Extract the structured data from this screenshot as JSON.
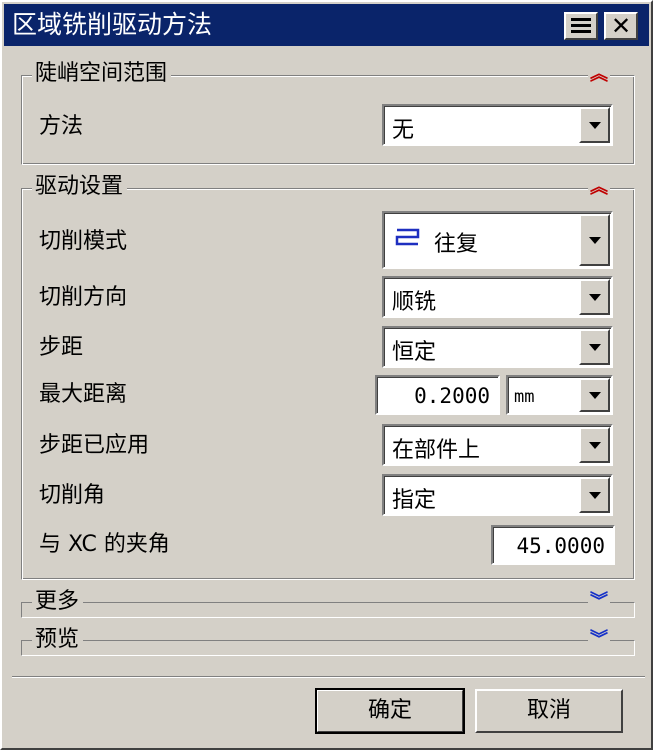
{
  "window": {
    "title": "区域铣削驱动方法",
    "close_symbol": "✕"
  },
  "steep_group": {
    "title": "陡峭空间范围",
    "method_label": "方法",
    "method_value": "无"
  },
  "drive_group": {
    "title": "驱动设置",
    "cut_pattern_label": "切削模式",
    "cut_pattern_value": "往复",
    "cut_direction_label": "切削方向",
    "cut_direction_value": "顺铣",
    "stepover_label": "步距",
    "stepover_value": "恒定",
    "max_distance_label": "最大距离",
    "max_distance_value": "0.2000",
    "max_distance_unit": "mm",
    "stepover_applied_label": "步距已应用",
    "stepover_applied_value": "在部件上",
    "cut_angle_label": "切削角",
    "cut_angle_value": "指定",
    "xc_angle_label": "与 XC 的夹角",
    "xc_angle_value": "45.0000"
  },
  "more_group": {
    "title": "更多"
  },
  "preview_group": {
    "title": "预览"
  },
  "buttons": {
    "ok_label": "确定",
    "cancel_label": "取消"
  },
  "icons": {
    "collapse": "double-chevron-up-icon",
    "expand": "double-chevron-down-icon",
    "zigzag": "zig-zag-pattern-icon"
  },
  "colors": {
    "titlebar": "#0a246a",
    "collapse_chevron": "#c00000",
    "expand_chevron": "#1530c8",
    "zigzag_icon": "#1e2fc0",
    "dialog_bg": "#d4d0c8"
  }
}
